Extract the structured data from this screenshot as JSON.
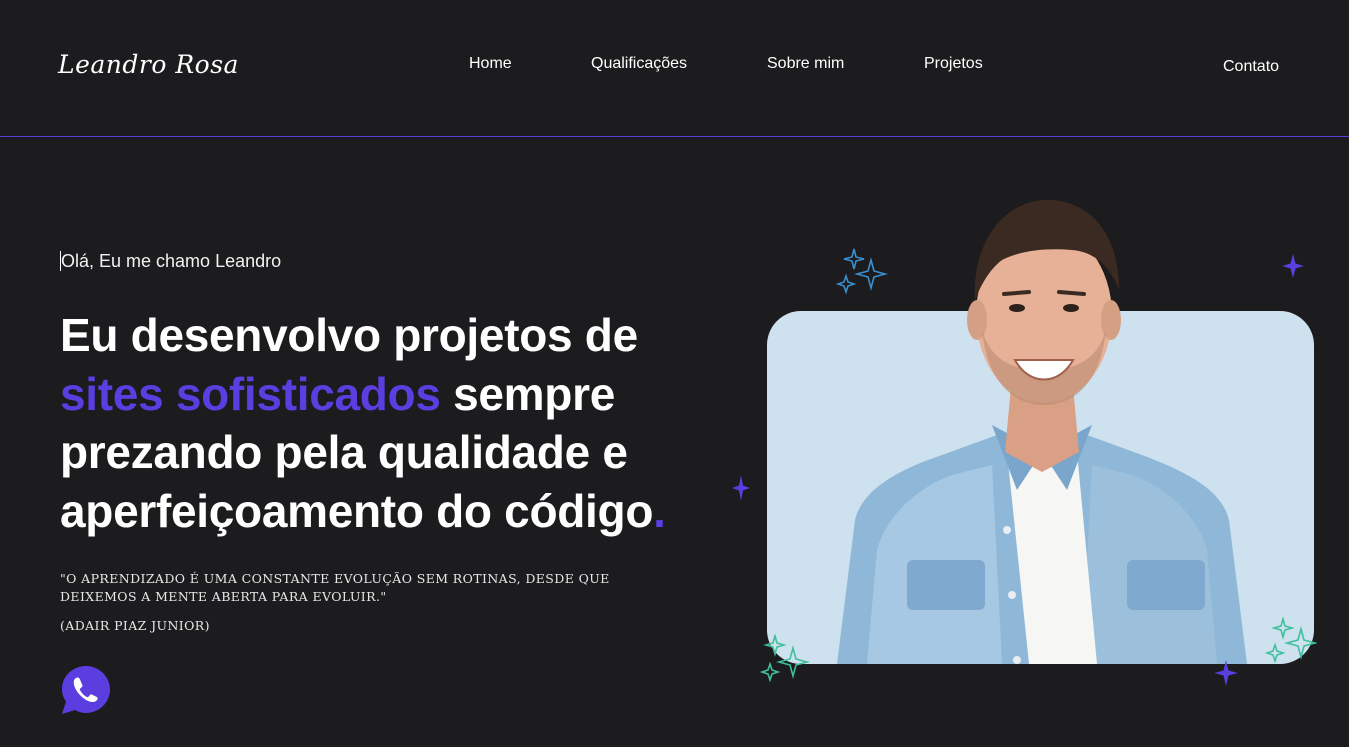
{
  "brand": {
    "logo_text": "Leandro Rosa"
  },
  "nav": {
    "items": [
      {
        "label": "Home"
      },
      {
        "label": "Qualificações"
      },
      {
        "label": "Sobre mim"
      },
      {
        "label": "Projetos"
      }
    ],
    "contact_label": "Contato"
  },
  "hero": {
    "greeting": "Olá, Eu me chamo Leandro",
    "headline": {
      "part1": "Eu desenvolvo projetos de",
      "accent": "sites sofisticados",
      "part2": " sempre prezando pela qualidade e aperfeiçoamento do código",
      "dot": "."
    },
    "quote": "\"O aprendizado é uma constante evolução sem rotinas, desde que deixemos a mente aberta para evoluir.\"",
    "author": "(ADAIR PIAZ JUNIOR)",
    "whatsapp_icon": "whatsapp-icon"
  },
  "colors": {
    "background": "#1c1b1d",
    "accent": "#5b3ee0",
    "card": "#cde2ee",
    "sparkle_blue": "#3a8fd0",
    "sparkle_green": "#3fbf9c"
  }
}
